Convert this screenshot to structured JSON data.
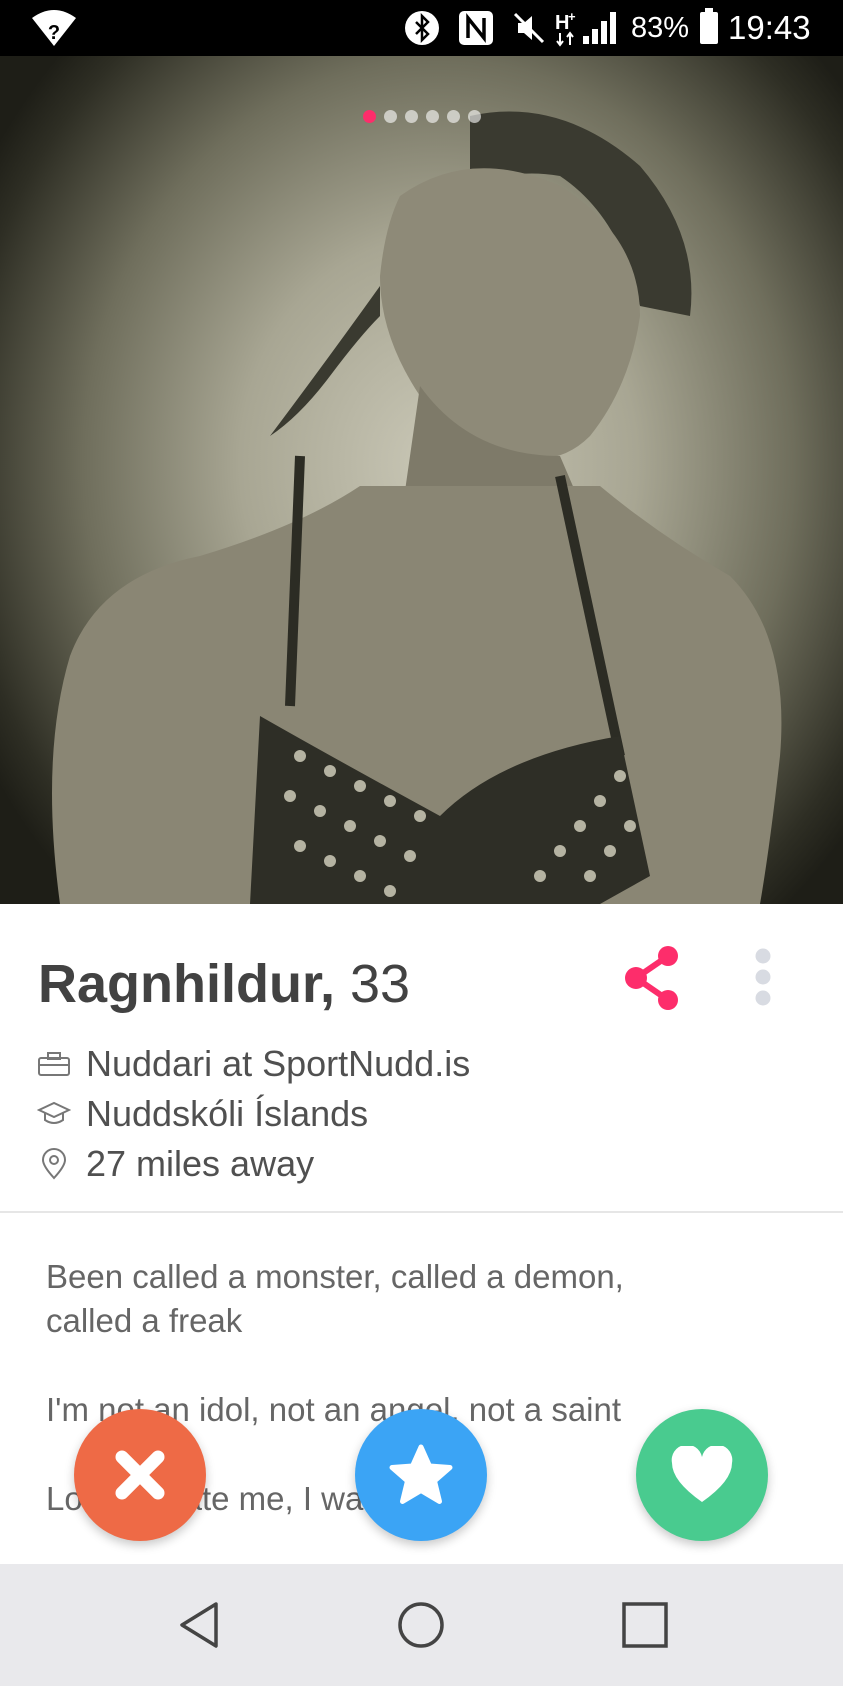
{
  "status_bar": {
    "battery_percent": "83%",
    "time": "19:43",
    "icons": [
      "wifi-unknown-icon",
      "bluetooth-icon",
      "nfc-icon",
      "mute-icon",
      "h-plus-signal-icon",
      "cell-signal-icon",
      "battery-icon"
    ]
  },
  "photo": {
    "description_icon": "profile-photo",
    "page_count": 6,
    "active_page": 1
  },
  "profile": {
    "name": "Ragnhildur,",
    "age": "33",
    "job": "Nuddari at SportNudd.is",
    "school": "Nuddskóli Íslands",
    "distance": "27 miles away"
  },
  "bio": {
    "para1": "Been called a monster, called a demon,\ncalled a freak",
    "para2": "I'm not an idol, not an angel, not a saint",
    "para3": "Love or hate me, I walk alone"
  },
  "actions": {
    "nope_icon": "close-icon",
    "super_like_icon": "star-icon",
    "like_icon": "heart-icon"
  },
  "colors": {
    "accent": "#fd2d6b",
    "nope": "#ee6a46",
    "super_like": "#3ba4f5",
    "like": "#49cb8f"
  },
  "nav": {
    "icons": [
      "back-icon",
      "home-icon",
      "recents-icon"
    ]
  }
}
